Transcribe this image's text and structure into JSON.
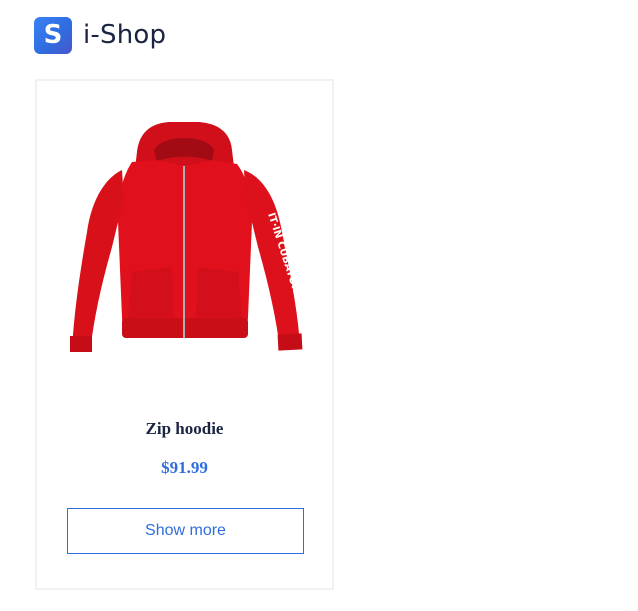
{
  "header": {
    "logo_letter": "S",
    "brand_name": "i-Shop"
  },
  "product": {
    "name": "Zip hoodie",
    "price": "$91.99",
    "image_alt_icon": "red-zip-hoodie-image",
    "sleeve_print": "IT·IN CUBATOR",
    "color": "#e0101c"
  },
  "actions": {
    "show_more_label": "Show more"
  },
  "colors": {
    "accent": "#2f6de0",
    "text_dark": "#1b2440"
  }
}
